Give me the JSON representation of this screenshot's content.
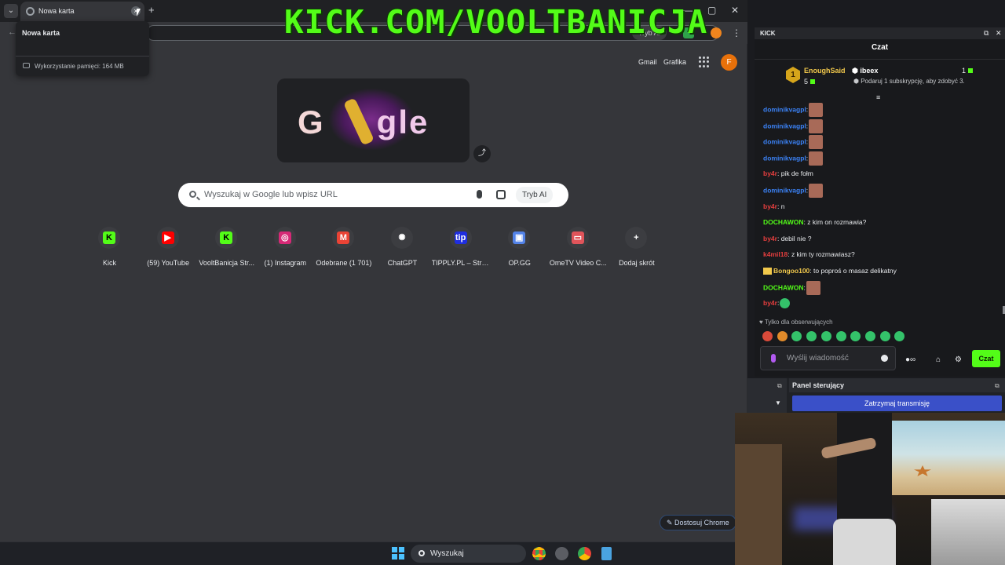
{
  "overlay": {
    "title": "KICK.COM/VOOLTBANICJA"
  },
  "browser": {
    "tab_title": "Nowa karta",
    "tab_close": "×",
    "new_tab": "+",
    "tab_list": "⌄",
    "hover_card": {
      "title": "Nowa karta",
      "memory": "Wykorzystanie pamięci: 164 MB"
    },
    "omnibox_ai": "Tryb AI",
    "window_controls": {
      "minimize": "—",
      "maximize": "▢",
      "close": "✕"
    },
    "menu": "⋮",
    "back": "←"
  },
  "newtab": {
    "links": [
      "Gmail",
      "Grafika"
    ],
    "profile_initial": "F",
    "search_placeholder": "Wyszukaj w Google lub wpisz URL",
    "ai_mode": "Tryb AI",
    "share": "⤴",
    "doodle_text_left": "G",
    "doodle_text_right": "gle",
    "shortcuts": [
      {
        "label": "Kick",
        "icon": "K",
        "color": "#53fc18"
      },
      {
        "label": "(59) YouTube",
        "icon": "▶",
        "color": "#ff0000"
      },
      {
        "label": "VooltBanicja Str...",
        "icon": "K",
        "color": "#53fc18"
      },
      {
        "label": "(1) Instagram",
        "icon": "◎",
        "color": "#d62976"
      },
      {
        "label": "Odebrane (1 701)",
        "icon": "M",
        "color": "#ea4335"
      },
      {
        "label": "ChatGPT",
        "icon": "✺",
        "color": "#3c3d41"
      },
      {
        "label": "TIPPLY.PL – Stre...",
        "icon": "tip",
        "color": "#1f2ee0"
      },
      {
        "label": "OP.GG",
        "icon": "▣",
        "color": "#5383e8"
      },
      {
        "label": "OmeTV Video C...",
        "icon": "▭",
        "color": "#e0545a"
      },
      {
        "label": "Dodaj skrót",
        "icon": "+",
        "color": "#3c3d41"
      }
    ],
    "customize": "Dostosuj Chrome"
  },
  "taskbar": {
    "search": "Wyszukaj"
  },
  "kick": {
    "header": "KICK",
    "chat_title": "Czat",
    "pinned": {
      "badge": "1",
      "user": "EnoughSaid",
      "count": "5",
      "target": "ibeex",
      "gift_text": "Podaruj 1 subskrypcję, aby zdobyć 3.",
      "right_count": "1"
    },
    "messages": [
      {
        "user": "dominikvagpl",
        "color": "#3b82f6",
        "text": "",
        "emote": true
      },
      {
        "user": "dominikvagpl",
        "color": "#3b82f6",
        "text": "",
        "emote": true
      },
      {
        "user": "dominikvagpl",
        "color": "#3b82f6",
        "text": "",
        "emote": true
      },
      {
        "user": "dominikvagpl",
        "color": "#3b82f6",
        "text": "",
        "emote": true
      },
      {
        "user": "by4r",
        "color": "#e53e3e",
        "text": " pik de fołm",
        "emote": false
      },
      {
        "user": "dominikvagpl",
        "color": "#3b82f6",
        "text": "",
        "emote": true
      },
      {
        "user": "by4r",
        "color": "#e53e3e",
        "text": " n",
        "emote": false
      },
      {
        "user": "DOCHAWON",
        "color": "#53fc18",
        "text": " z kim on rozmawia?",
        "emote": false
      },
      {
        "user": "by4r",
        "color": "#e53e3e",
        "text": " debil nie ?",
        "emote": false
      },
      {
        "user": "k4mil18",
        "color": "#e53e3e",
        "text": " z kim ty rozmawiasz?",
        "emote": false
      },
      {
        "user": "Bongoo100",
        "color": "#f2c94c",
        "text": " to poproś o masaz delikatny",
        "emote": false
      },
      {
        "user": "DOCHAWON",
        "color": "#53fc18",
        "text": "",
        "emote": true
      },
      {
        "user": "by4r",
        "color": "#e53e3e",
        "text": "",
        "emote": true
      }
    ],
    "followers_only": "Tylko dla obserwujących",
    "input_placeholder": "Wyślij wiadomość",
    "send": "Czat"
  },
  "control_panel": {
    "title": "Panel sterujący",
    "stop": "Zatrzymaj transmisję"
  }
}
